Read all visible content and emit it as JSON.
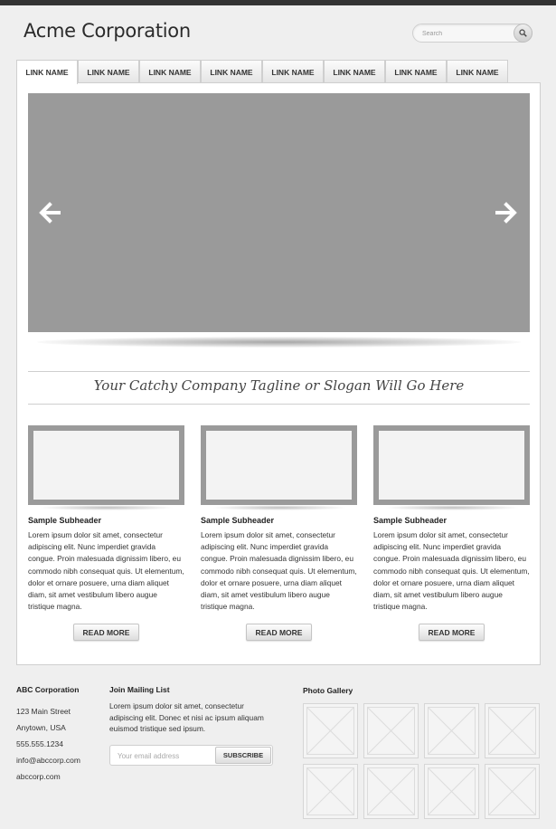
{
  "header": {
    "logo": "Acme Corporation",
    "search_placeholder": "Search"
  },
  "nav": {
    "tabs": [
      "LINK NAME",
      "LINK NAME",
      "LINK NAME",
      "LINK NAME",
      "LINK NAME",
      "LINK NAME",
      "LINK NAME",
      "LINK NAME"
    ],
    "active_index": 0
  },
  "hero": {
    "tagline": "Your Catchy Company Tagline or Slogan Will Go Here"
  },
  "columns": [
    {
      "subheader": "Sample Subheader",
      "body": "Lorem ipsum dolor sit amet, consectetur adipiscing elit. Nunc imperdiet gravida congue. Proin malesuada dignissim libero, eu commodo nibh consequat quis. Ut elementum, dolor et ornare posuere, urna diam aliquet diam, sit amet vestibulum libero augue tristique magna.",
      "button": "READ MORE"
    },
    {
      "subheader": "Sample Subheader",
      "body": "Lorem ipsum dolor sit amet, consectetur adipiscing elit. Nunc imperdiet gravida congue. Proin malesuada dignissim libero, eu commodo nibh consequat quis. Ut elementum, dolor et ornare posuere, urna diam aliquet diam, sit amet vestibulum libero augue tristique magna.",
      "button": "READ MORE"
    },
    {
      "subheader": "Sample Subheader",
      "body": "Lorem ipsum dolor sit amet, consectetur adipiscing elit. Nunc imperdiet gravida congue. Proin malesuada dignissim libero, eu commodo nibh consequat quis. Ut elementum, dolor et ornare posuere, urna diam aliquet diam, sit amet vestibulum libero augue tristique magna.",
      "button": "READ MORE"
    }
  ],
  "footer": {
    "company": {
      "title": "ABC Corporation",
      "street": "123 Main Street",
      "city": "Anytown, USA",
      "phone": "555.555.1234",
      "email": "info@abccorp.com",
      "website": "abccorp.com"
    },
    "mailing": {
      "title": "Join Mailing List",
      "text": "Lorem ipsum dolor sit amet, consectetur adipiscing elit. Donec et nisi ac ipsum aliquam euismod tristique sed ipsum.",
      "placeholder": "Your email address",
      "button": "SUBSCRIBE"
    },
    "gallery": {
      "title": "Photo Gallery",
      "count": 8
    }
  },
  "colors": {
    "top_bar": "#333333",
    "slider": "#9a9a9a",
    "page_bg": "#efefef"
  }
}
